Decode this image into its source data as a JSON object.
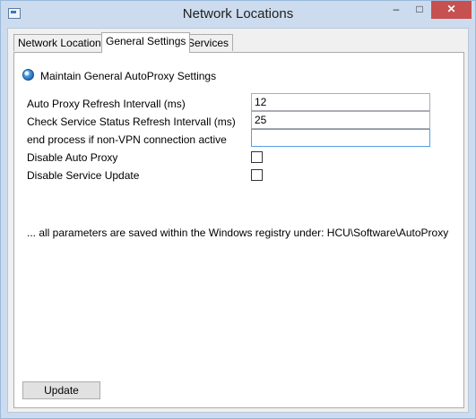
{
  "window": {
    "title": "Network Locations",
    "minimize_label": "–",
    "maximize_label": "□",
    "close_label": "✕"
  },
  "tabs": [
    {
      "label": "Network Location",
      "active": false
    },
    {
      "label": "General Settings",
      "active": true
    },
    {
      "label": "Services",
      "active": false
    }
  ],
  "panel": {
    "section_title": "Maintain General AutoProxy Settings",
    "section_icon": "globe-icon",
    "fields": {
      "auto_proxy_refresh": {
        "label": "Auto Proxy Refresh Intervall (ms)",
        "value": "12"
      },
      "service_status_refresh": {
        "label": "Check Service Status Refresh Intervall (ms)",
        "value": "25"
      },
      "end_process": {
        "label": "end process if non-VPN connection active",
        "value": ""
      }
    },
    "checkboxes": {
      "disable_auto_proxy": {
        "label": "Disable Auto Proxy",
        "checked": false
      },
      "disable_service_update": {
        "label": "Disable Service Update",
        "checked": false
      }
    },
    "note": "... all parameters are saved within the Windows registry under: HCU\\Software\\AutoProxy",
    "update_button": "Update"
  },
  "colors": {
    "frame": "#ccdcee",
    "close_button": "#c75050",
    "panel_background": "#ffffff",
    "client_background": "#f0f0f0",
    "focus_border": "#569de5"
  }
}
